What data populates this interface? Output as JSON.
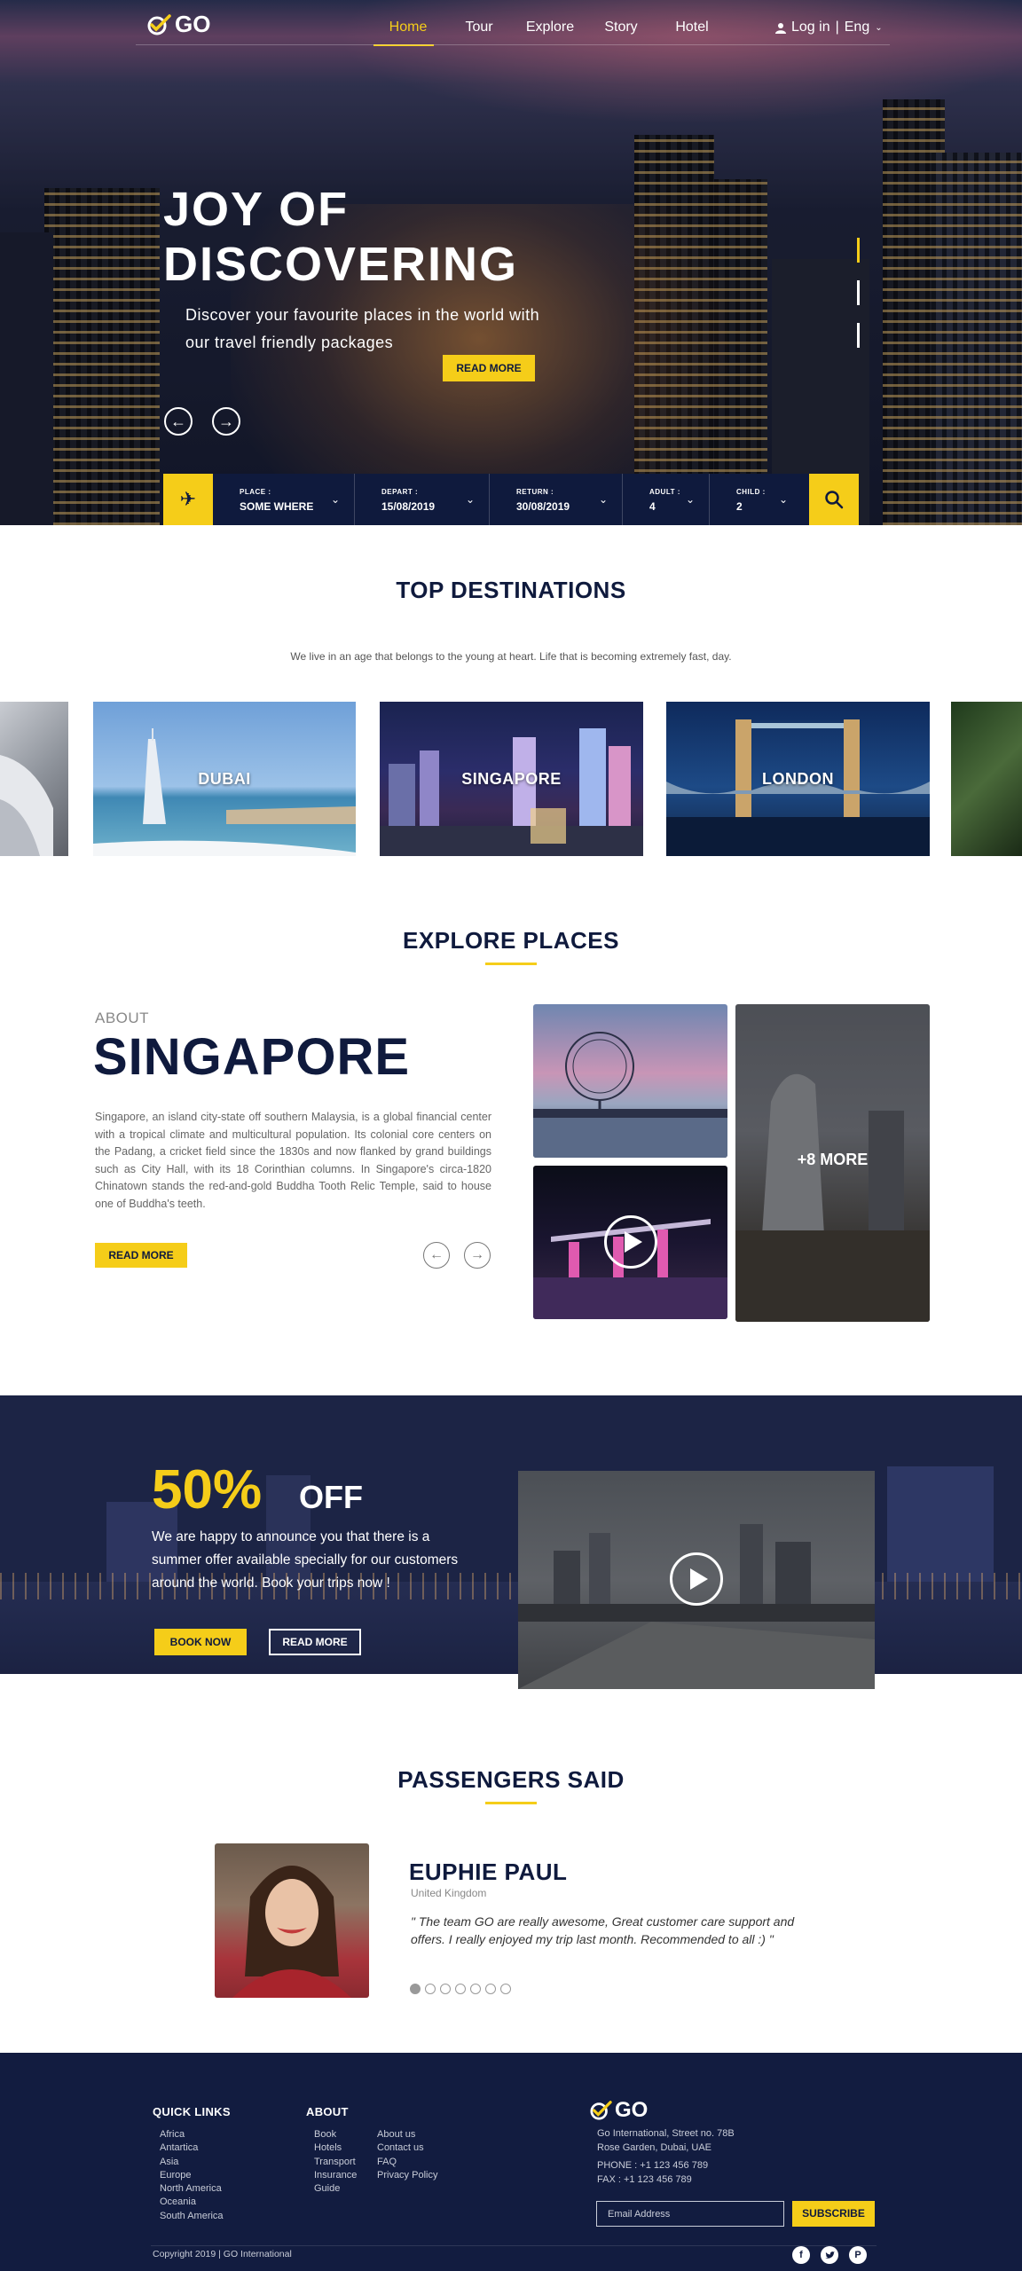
{
  "nav": {
    "logo": "GO",
    "items": [
      {
        "label": "Home",
        "active": true
      },
      {
        "label": "Tour"
      },
      {
        "label": "Explore"
      },
      {
        "label": "Story"
      },
      {
        "label": "Hotel"
      }
    ],
    "login": "Log in",
    "separator": "|",
    "language": "Eng"
  },
  "hero": {
    "title_line1": "JOY OF",
    "title_line2": "DISCOVERING",
    "subtitle": "Discover your favourite places in the world with our travel friendly packages",
    "read_more": "READ MORE"
  },
  "search": {
    "fields": [
      {
        "label": "PLACE :",
        "value": "SOME WHERE"
      },
      {
        "label": "DEPART :",
        "value": "15/08/2019"
      },
      {
        "label": "RETURN :",
        "value": "30/08/2019"
      },
      {
        "label": "ADULT :",
        "value": "4"
      },
      {
        "label": "CHILD :",
        "value": "2"
      }
    ]
  },
  "destinations": {
    "title": "TOP DESTINATIONS",
    "description": "We live in an age that belongs to the young at heart. Life that is becoming extremely fast, day.",
    "items": [
      {
        "name": "DUBAI"
      },
      {
        "name": "SINGAPORE"
      },
      {
        "name": "LONDON"
      }
    ]
  },
  "explore": {
    "title": "EXPLORE PLACES",
    "about_label": "ABOUT",
    "place": "SINGAPORE",
    "text": "Singapore, an island city-state off southern Malaysia, is a global financial center with a tropical climate and multicultural population. Its colonial core centers on the Padang, a cricket field since the 1830s and now flanked by grand buildings such as City Hall, with its 18 Corinthian columns. In Singapore's circa-1820 Chinatown stands the red-and-gold Buddha Tooth Relic Temple, said to house one of Buddha's teeth.",
    "read_more": "READ MORE",
    "more_label": "+8 MORE"
  },
  "promo": {
    "percent": "50%",
    "off": "OFF",
    "text": "We are happy to announce you that there is a summer offer available specially for our customers around the world. Book your trips now !",
    "book_now": "BOOK NOW",
    "read_more": "READ MORE"
  },
  "testimonials": {
    "title": "PASSENGERS SAID",
    "name": "EUPHIE PAUL",
    "country": "United Kingdom",
    "quote": "\" The team  GO are really awesome, Great customer care support and offers. I really enjoyed my trip last month. Recommended to all  :) \"",
    "slide_count": 7,
    "active_slide": 1
  },
  "footer": {
    "quick_links_title": "QUICK LINKS",
    "quick_links": [
      "Africa",
      "Antartica",
      "Asia",
      "Europe",
      "North America",
      "Oceania",
      "South America"
    ],
    "about_title": "ABOUT",
    "about_col1": [
      "Book",
      "Hotels",
      "Transport",
      "Insurance",
      "Guide"
    ],
    "about_col2": [
      "About us",
      "Contact us",
      "FAQ",
      "Privacy Policy"
    ],
    "logo": "GO",
    "address_line1": "Go International, Street no. 78B",
    "address_line2": "Rose Garden, Dubai, UAE",
    "phone": "PHONE : +1 123 456 789",
    "fax": "FAX : +1 123 456 789",
    "email_placeholder": "Email Address",
    "subscribe": "SUBSCRIBE",
    "copyright": "Copyright 2019 | GO International",
    "social": [
      "facebook-icon",
      "twitter-icon",
      "pinterest-icon"
    ]
  },
  "colors": {
    "accent": "#f5cd19",
    "navy": "#0f1a3d",
    "footer": "#121c40"
  }
}
